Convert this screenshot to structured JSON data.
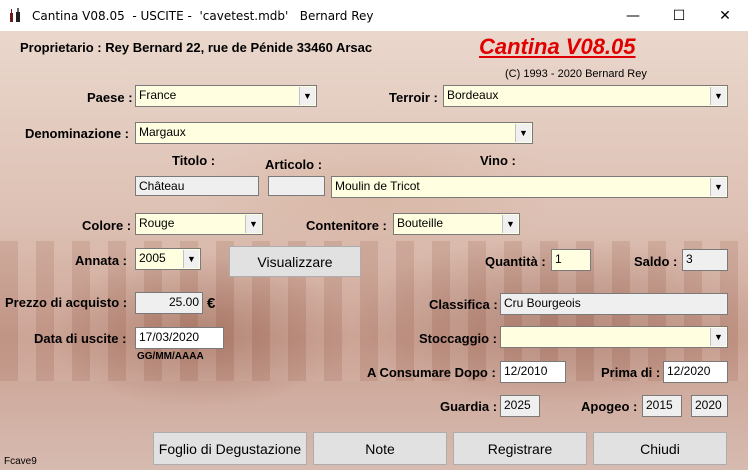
{
  "window": {
    "title": "Cantina V08.05  - USCITE -  'cavetest.mdb'   Bernard Rey",
    "minimize": "—",
    "maximize": "☐",
    "close": "✕"
  },
  "header": {
    "owner": "Proprietario : Rey Bernard 22, rue de Pénide 33460 Arsac",
    "brand": "Cantina V08.05",
    "copyright": "(C) 1993 - 2020 Bernard Rey"
  },
  "labels": {
    "paese": "Paese :",
    "terroir": "Terroir :",
    "denominazione": "Denominazione :",
    "titolo": "Titolo :",
    "articolo": "Articolo :",
    "vino": "Vino :",
    "colore": "Colore :",
    "contenitore": "Contenitore :",
    "annata": "Annata :",
    "quantita": "Quantità :",
    "saldo": "Saldo :",
    "prezzo": "Prezzo di acquisto :",
    "euro": "€",
    "classifica": "Classifica :",
    "data_uscita": "Data di uscite :",
    "date_format": "GG/MM/AAAA",
    "stoccaggio": "Stoccaggio :",
    "consumare": "A Consumare Dopo :",
    "prima": "Prima di :",
    "guardia": "Guardia :",
    "apogeo": "Apogeo :"
  },
  "values": {
    "paese": "France",
    "terroir": "Bordeaux",
    "denominazione": "Margaux",
    "titolo": "Château",
    "articolo": "",
    "vino": "Moulin de Tricot",
    "colore": "Rouge",
    "contenitore": "Bouteille",
    "annata": "2005",
    "quantita": "1",
    "saldo": "3",
    "prezzo": "25.00",
    "classifica": "Cru Bourgeois",
    "data_uscita": "17/03/2020",
    "stoccaggio": "",
    "consumare": "12/2010",
    "prima": "12/2020",
    "guardia": "2025",
    "apogeo_from": "2015",
    "apogeo_to": "2020"
  },
  "buttons": {
    "visualizzare": "Visualizzare",
    "foglio": "Foglio di Degustazione",
    "note": "Note",
    "registrare": "Registrare",
    "chiudi": "Chiudi"
  },
  "footer": {
    "form_name": "Fcave9"
  }
}
